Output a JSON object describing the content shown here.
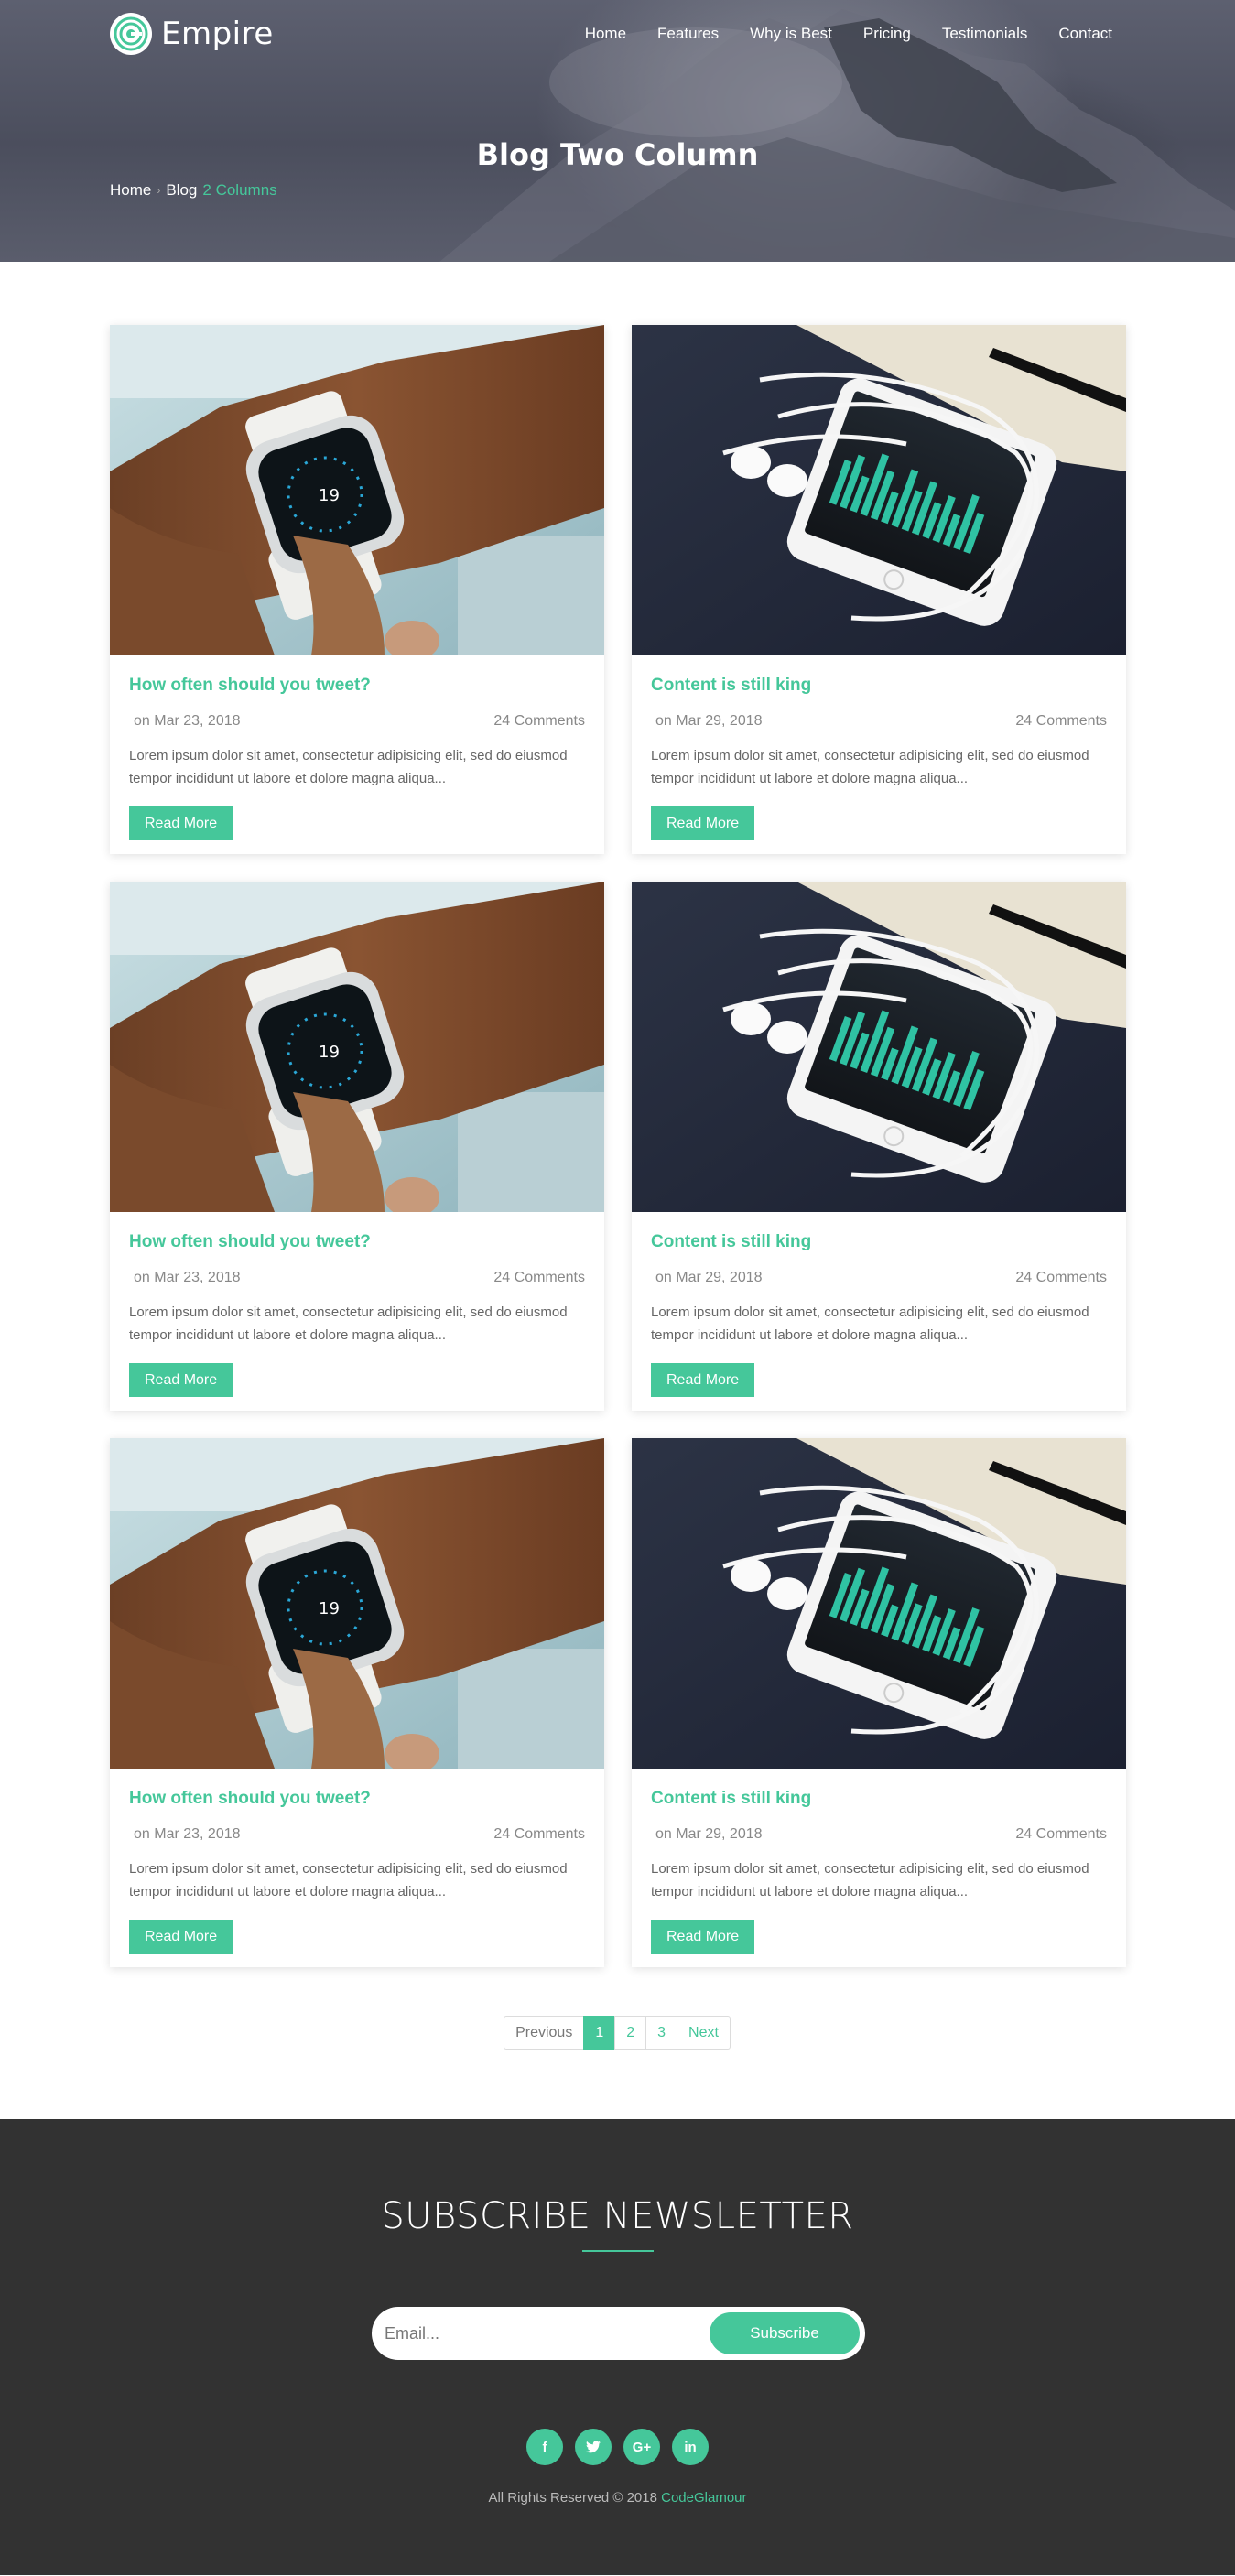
{
  "header": {
    "brand": "Empire",
    "nav": [
      "Home",
      "Features",
      "Why is Best",
      "Pricing",
      "Testimonials",
      "Contact"
    ]
  },
  "hero": {
    "title": "Blog Two Column",
    "breadcrumb": {
      "home": "Home",
      "section": "Blog",
      "current": "2 Columns"
    }
  },
  "posts": [
    {
      "title": "How often should you tweet?",
      "date": "on Mar 23, 2018",
      "comments": "24 Comments",
      "excerpt": "Lorem ipsum dolor sit amet, consectetur adipisicing elit, sed do eiusmod tempor incididunt ut labore et dolore magna aliqua...",
      "button": "Read More",
      "image": "smartwatch-photo"
    },
    {
      "title": "Content is still king",
      "date": "on Mar 29, 2018",
      "comments": "24 Comments",
      "excerpt": "Lorem ipsum dolor sit amet, consectetur adipisicing elit, sed do eiusmod tempor incididunt ut labore et dolore magna aliqua...",
      "button": "Read More",
      "image": "phone-earphones-photo"
    },
    {
      "title": "How often should you tweet?",
      "date": "on Mar 23, 2018",
      "comments": "24 Comments",
      "excerpt": "Lorem ipsum dolor sit amet, consectetur adipisicing elit, sed do eiusmod tempor incididunt ut labore et dolore magna aliqua...",
      "button": "Read More",
      "image": "smartwatch-photo"
    },
    {
      "title": "Content is still king",
      "date": "on Mar 29, 2018",
      "comments": "24 Comments",
      "excerpt": "Lorem ipsum dolor sit amet, consectetur adipisicing elit, sed do eiusmod tempor incididunt ut labore et dolore magna aliqua...",
      "button": "Read More",
      "image": "phone-earphones-photo"
    },
    {
      "title": "How often should you tweet?",
      "date": "on Mar 23, 2018",
      "comments": "24 Comments",
      "excerpt": "Lorem ipsum dolor sit amet, consectetur adipisicing elit, sed do eiusmod tempor incididunt ut labore et dolore magna aliqua...",
      "button": "Read More",
      "image": "smartwatch-photo"
    },
    {
      "title": "Content is still king",
      "date": "on Mar 29, 2018",
      "comments": "24 Comments",
      "excerpt": "Lorem ipsum dolor sit amet, consectetur adipisicing elit, sed do eiusmod tempor incididunt ut labore et dolore magna aliqua...",
      "button": "Read More",
      "image": "phone-earphones-photo"
    }
  ],
  "pagination": {
    "previous": "Previous",
    "pages": [
      "1",
      "2",
      "3"
    ],
    "active": "1",
    "next": "Next"
  },
  "footer": {
    "newsletter_title": "SUBSCRIBE NEWSLETTER",
    "email_placeholder": "Email...",
    "subscribe_label": "Subscribe",
    "socials": [
      {
        "icon": "facebook-icon",
        "glyph": "f"
      },
      {
        "icon": "twitter-icon",
        "glyph": "t"
      },
      {
        "icon": "google-plus-icon",
        "glyph": "G+"
      },
      {
        "icon": "linkedin-icon",
        "glyph": "in"
      }
    ],
    "copyright_text": "All Rights Reserved © 2018",
    "copyright_brand": "CodeGlamour"
  },
  "colors": {
    "accent": "#45c79a",
    "footer_bg": "#323232",
    "hero_bg": "#535665"
  }
}
